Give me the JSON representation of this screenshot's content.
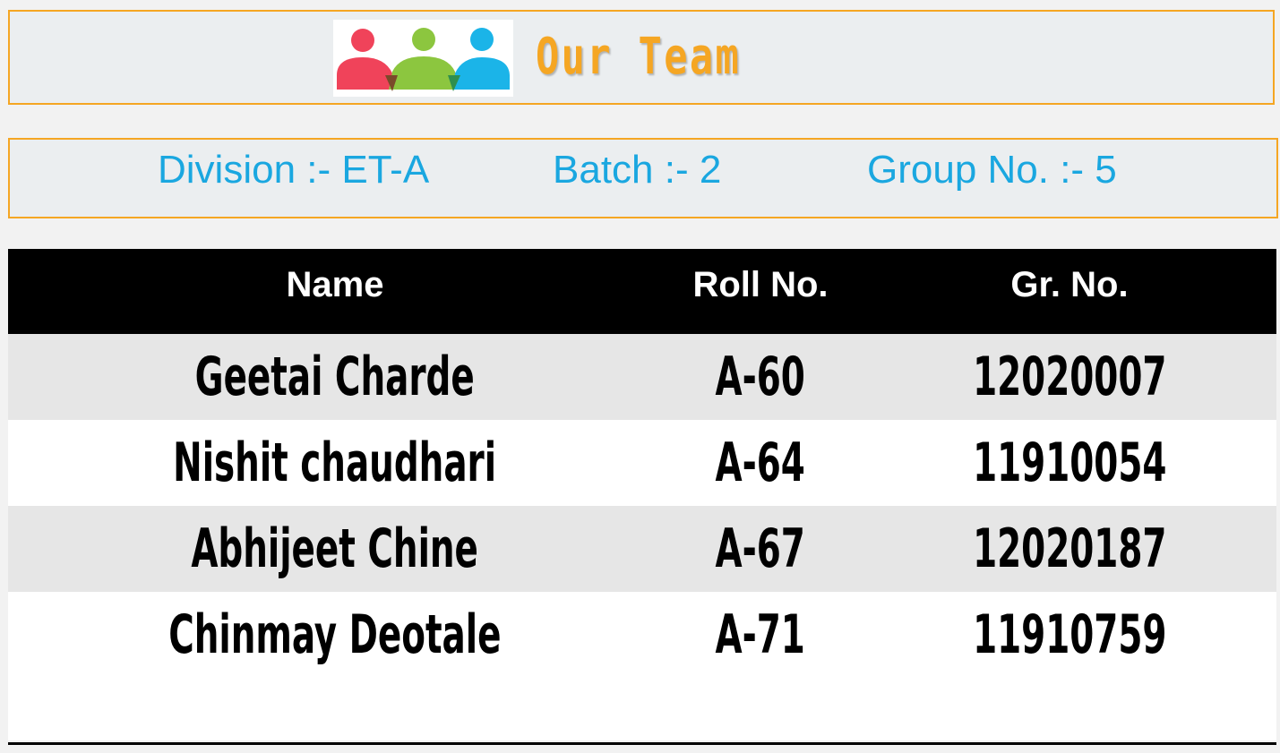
{
  "header": {
    "title": "Our Team",
    "logo_icon": "team-people-icon",
    "logo_colors": [
      "#f0435a",
      "#8cc63f",
      "#1bb4e8"
    ]
  },
  "info": {
    "division": "Division :- ET-A",
    "batch": "Batch :- 2",
    "group": "Group No. :- 5"
  },
  "table": {
    "headers": [
      "Name",
      "Roll No.",
      "Gr. No."
    ],
    "rows": [
      {
        "name": "Geetai Charde",
        "roll": "A-60",
        "gr": "12020007"
      },
      {
        "name": "Nishit chaudhari",
        "roll": "A-64",
        "gr": "11910054"
      },
      {
        "name": "Abhijeet Chine",
        "roll": "A-67",
        "gr": "12020187"
      },
      {
        "name": "Chinmay Deotale",
        "roll": "A-71",
        "gr": "11910759"
      }
    ]
  },
  "colors": {
    "accent": "#f5a623",
    "info_text": "#1aa7e0",
    "header_bg": "#000000"
  }
}
